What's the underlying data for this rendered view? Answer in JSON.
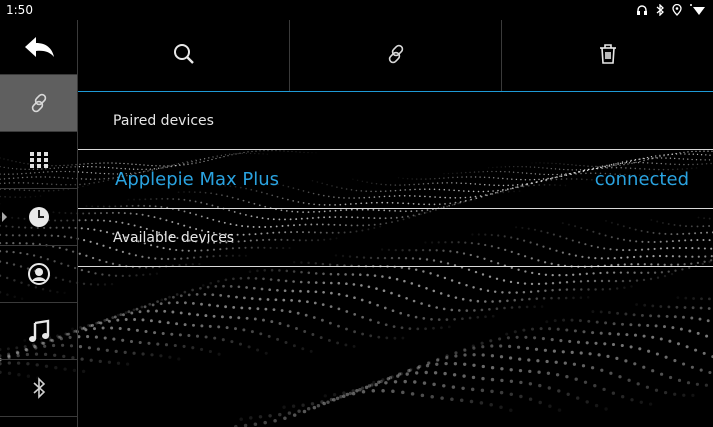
{
  "status_bar": {
    "time": "1:50",
    "icons": [
      "headphones-icon",
      "bluetooth-icon",
      "location-icon",
      "wifi-icon"
    ]
  },
  "sidebar": {
    "items": [
      {
        "name": "back",
        "icon": "back-arrow-icon"
      },
      {
        "name": "link",
        "icon": "link-icon",
        "active": true
      },
      {
        "name": "dialpad",
        "icon": "dialpad-icon"
      },
      {
        "name": "recent",
        "icon": "clock-icon"
      },
      {
        "name": "contacts",
        "icon": "contact-icon"
      },
      {
        "name": "music",
        "icon": "music-note-icon"
      },
      {
        "name": "bluetooth",
        "icon": "bluetooth-icon"
      }
    ]
  },
  "toolbar": {
    "buttons": [
      {
        "name": "search",
        "icon": "search-icon"
      },
      {
        "name": "pair",
        "icon": "link-icon"
      },
      {
        "name": "delete",
        "icon": "trash-icon"
      }
    ]
  },
  "paired": {
    "label": "Paired devices",
    "devices": [
      {
        "name": "Applepie Max Plus",
        "status": "connected"
      }
    ]
  },
  "available": {
    "label": "Available devices"
  },
  "colors": {
    "accent": "#2aa3e0",
    "active_sidebar": "#5f5f5f",
    "background": "#000000"
  }
}
